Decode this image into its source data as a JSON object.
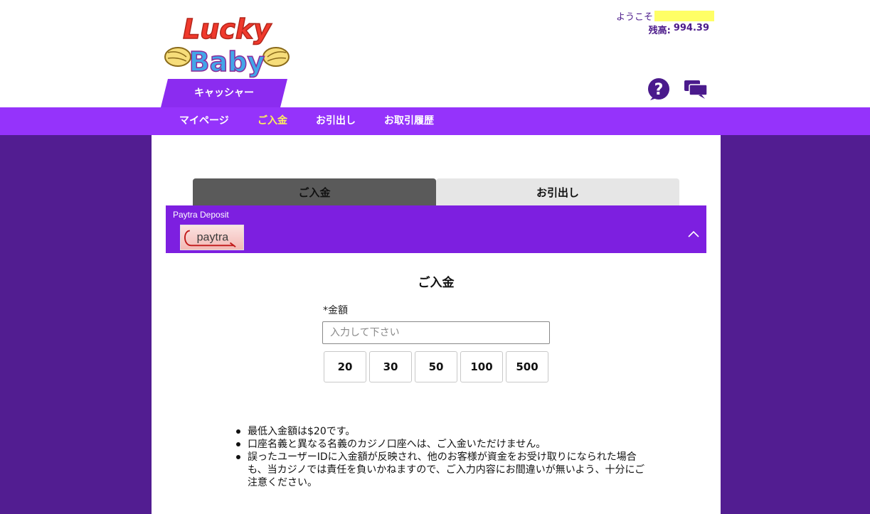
{
  "header": {
    "logo": {
      "line1": "Lucky",
      "line2": "Baby"
    },
    "cashier_tab": "キャッシャー",
    "welcome_label": "ようこそ",
    "balance_label": "残高:",
    "balance_value": "994.39",
    "icons": [
      "help-icon",
      "chat-icon"
    ]
  },
  "nav": {
    "items": [
      {
        "label": "マイページ",
        "active": false
      },
      {
        "label": "ご入金",
        "active": true
      },
      {
        "label": "お引出し",
        "active": false
      },
      {
        "label": "お取引履歴",
        "active": false
      }
    ]
  },
  "tabs": [
    {
      "label": "ご入金",
      "active": true
    },
    {
      "label": "お引出し",
      "active": false
    }
  ],
  "method": {
    "name": "Paytra Deposit",
    "logo_text": "paytra"
  },
  "form": {
    "title": "ご入金",
    "amount_label": "*金額",
    "amount_value": "",
    "amount_placeholder": "入力して下さい",
    "presets": [
      "20",
      "30",
      "50",
      "100",
      "500"
    ]
  },
  "notes": [
    "最低入金額は$20です。",
    "口座名義と異なる名義のカジノ口座へは、ご入金いただけません。",
    "誤ったユーザーIDに入金額が反映され、他のお客様が資金をお受け取りになられた場合も、当カジノでは責任を負いかねますので、ご入力内容にお間違いが無いよう、十分にご注意ください。"
  ],
  "colors": {
    "background": "#521d91",
    "nav_bar": "#9533fb",
    "nav_active": "#fff25c",
    "method_bar": "#7d1fe0",
    "tab_active": "#5a5a5a",
    "tab_inactive": "#e6e6e6",
    "welcome_highlight": "#ffff66"
  }
}
